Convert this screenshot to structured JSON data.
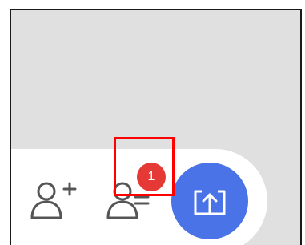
{
  "toolbar": {
    "add_contact_icon": "person-add-icon",
    "remove_contact_icon": "person-remove-icon",
    "notification_badge": "1",
    "badge_color": "#e53935",
    "share_button_color": "#4a73e8",
    "share_icon": "share-upload-icon"
  },
  "annotation": {
    "highlight_color": "#ff0000"
  }
}
